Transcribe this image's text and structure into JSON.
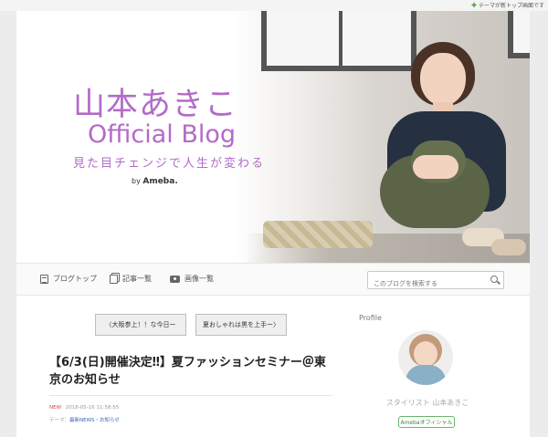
{
  "topbar": {
    "notice": "テーマが新トップ画面です"
  },
  "header": {
    "name": "山本あきこ",
    "subtitle": "Official Blog",
    "tagline": "見た目チェンジで人生が変わる",
    "by_prefix": "by",
    "by_brand": "Ameba."
  },
  "nav": {
    "items": [
      {
        "label": "ブログトップ",
        "icon": "blog-top-icon"
      },
      {
        "label": "記事一覧",
        "icon": "articles-icon"
      },
      {
        "label": "画像一覧",
        "icon": "camera-icon"
      }
    ],
    "search_placeholder": "このブログを検索する"
  },
  "pager": {
    "prev_label": "〈大阪参上！！な今日ー",
    "next_label": "夏おしゃれは黒を上手ー〉"
  },
  "post": {
    "title": "【6/3(日)開催決定‼】夏ファッションセミナー＠東京のお知らせ",
    "new_badge": "NEW",
    "date": "2018-05-16 11:58:55",
    "theme_prefix": "テーマ：",
    "theme": "最新NEWS・お知らせ"
  },
  "sidebar": {
    "title": "Profile",
    "name": "スタイリスト 山本あきこ",
    "badge": "Amebaオフィシャル"
  },
  "colors": {
    "brand_purple": "#b36bc8",
    "link_blue": "#3a62b0",
    "official_green": "#3a8a3a"
  }
}
